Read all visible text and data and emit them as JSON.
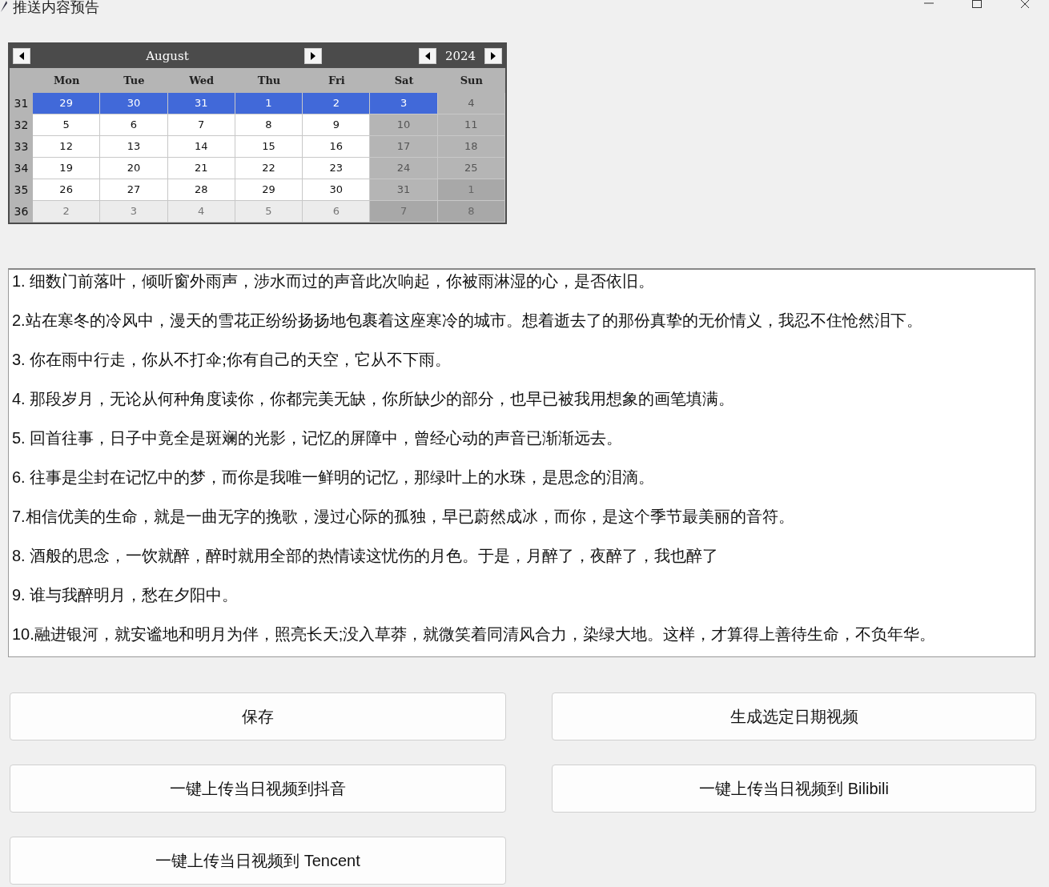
{
  "window": {
    "title": "推送内容预告"
  },
  "calendar": {
    "month": "August",
    "year": "2024",
    "weekdays": [
      "Mon",
      "Tue",
      "Wed",
      "Thu",
      "Fri",
      "Sat",
      "Sun"
    ],
    "weeks": [
      {
        "number": "31",
        "days": [
          {
            "day": "29",
            "kind": "weekday",
            "selected": true
          },
          {
            "day": "30",
            "kind": "weekday",
            "selected": true
          },
          {
            "day": "31",
            "kind": "weekday",
            "selected": true
          },
          {
            "day": "1",
            "kind": "weekday",
            "selected": true
          },
          {
            "day": "2",
            "kind": "weekday",
            "selected": true
          },
          {
            "day": "3",
            "kind": "weekend",
            "selected": true
          },
          {
            "day": "4",
            "kind": "weekend",
            "selected": false
          }
        ]
      },
      {
        "number": "32",
        "days": [
          {
            "day": "5",
            "kind": "weekday",
            "selected": false
          },
          {
            "day": "6",
            "kind": "weekday",
            "selected": false
          },
          {
            "day": "7",
            "kind": "weekday",
            "selected": false
          },
          {
            "day": "8",
            "kind": "weekday",
            "selected": false
          },
          {
            "day": "9",
            "kind": "weekday",
            "selected": false
          },
          {
            "day": "10",
            "kind": "weekend",
            "selected": false
          },
          {
            "day": "11",
            "kind": "weekend",
            "selected": false
          }
        ]
      },
      {
        "number": "33",
        "days": [
          {
            "day": "12",
            "kind": "weekday",
            "selected": false
          },
          {
            "day": "13",
            "kind": "weekday",
            "selected": false
          },
          {
            "day": "14",
            "kind": "weekday",
            "selected": false
          },
          {
            "day": "15",
            "kind": "weekday",
            "selected": false
          },
          {
            "day": "16",
            "kind": "weekday",
            "selected": false
          },
          {
            "day": "17",
            "kind": "weekend",
            "selected": false
          },
          {
            "day": "18",
            "kind": "weekend",
            "selected": false
          }
        ]
      },
      {
        "number": "34",
        "days": [
          {
            "day": "19",
            "kind": "weekday",
            "selected": false
          },
          {
            "day": "20",
            "kind": "weekday",
            "selected": false
          },
          {
            "day": "21",
            "kind": "weekday",
            "selected": false
          },
          {
            "day": "22",
            "kind": "weekday",
            "selected": false
          },
          {
            "day": "23",
            "kind": "weekday",
            "selected": false
          },
          {
            "day": "24",
            "kind": "weekend",
            "selected": false
          },
          {
            "day": "25",
            "kind": "weekend",
            "selected": false
          }
        ]
      },
      {
        "number": "35",
        "days": [
          {
            "day": "26",
            "kind": "weekday",
            "selected": false
          },
          {
            "day": "27",
            "kind": "weekday",
            "selected": false
          },
          {
            "day": "28",
            "kind": "weekday",
            "selected": false
          },
          {
            "day": "29",
            "kind": "weekday",
            "selected": false
          },
          {
            "day": "30",
            "kind": "weekday",
            "selected": false
          },
          {
            "day": "31",
            "kind": "weekend",
            "selected": false
          },
          {
            "day": "1",
            "kind": "other_weekend",
            "selected": false
          }
        ]
      },
      {
        "number": "36",
        "days": [
          {
            "day": "2",
            "kind": "other_weekday",
            "selected": false
          },
          {
            "day": "3",
            "kind": "other_weekday",
            "selected": false
          },
          {
            "day": "4",
            "kind": "other_weekday",
            "selected": false
          },
          {
            "day": "5",
            "kind": "other_weekday",
            "selected": false
          },
          {
            "day": "6",
            "kind": "other_weekday",
            "selected": false
          },
          {
            "day": "7",
            "kind": "other_weekend",
            "selected": false
          },
          {
            "day": "8",
            "kind": "other_weekend",
            "selected": false
          }
        ]
      }
    ]
  },
  "content_lines": [
    "1. 细数门前落叶，倾听窗外雨声，涉水而过的声音此次响起，你被雨淋湿的心，是否依旧。",
    "2.站在寒冬的冷风中，漫天的雪花正纷纷扬扬地包裹着这座寒冷的城市。想着逝去了的那份真挚的无价情义，我忍不住怆然泪下。",
    "3. 你在雨中行走，你从不打伞;你有自己的天空，它从不下雨。",
    "4. 那段岁月，无论从何种角度读你，你都完美无缺，你所缺少的部分，也早已被我用想象的画笔填满。",
    "5. 回首往事，日子中竟全是斑斓的光影，记忆的屏障中，曾经心动的声音已渐渐远去。",
    "6. 往事是尘封在记忆中的梦，而你是我唯一鲜明的记忆，那绿叶上的水珠，是思念的泪滴。",
    "7.相信优美的生命，就是一曲无字的挽歌，漫过心际的孤独，早已蔚然成冰，而你，是这个季节最美丽的音符。",
    "8. 酒般的思念，一饮就醉，醉时就用全部的热情读这忧伤的月色。于是，月醉了，夜醉了，我也醉了",
    "9. 谁与我醉明月，愁在夕阳中。",
    "10.融进银河，就安谧地和明月为伴，照亮长天;没入草莽，就微笑着同清风合力，染绿大地。这样，才算得上善待生命，不负年华。"
  ],
  "buttons": [
    "保存",
    "生成选定日期视频",
    "一键上传当日视频到抖音",
    "一键上传当日视频到 Bilibili",
    "一键上传当日视频到 Tencent"
  ]
}
